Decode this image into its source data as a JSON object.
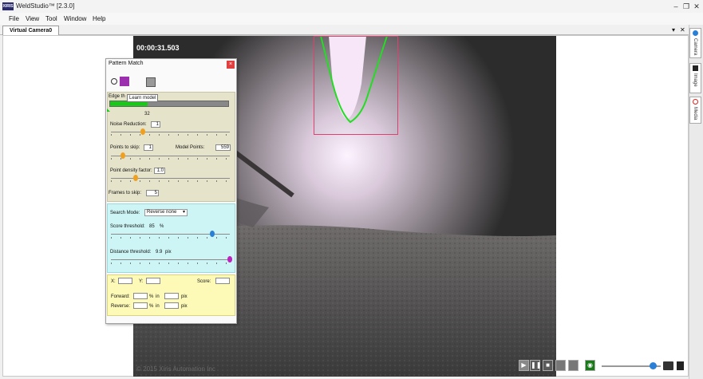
{
  "app": {
    "title": "WeldStudio™ [2.3.0]",
    "logo_text": "XIRIS"
  },
  "window_controls": {
    "minimize": "–",
    "restore": "❐",
    "close": "✕"
  },
  "menu": [
    "File",
    "View",
    "Tool",
    "Window",
    "Help"
  ],
  "tabs": [
    {
      "label": "Virtual Camera0"
    }
  ],
  "tab_controls": {
    "dropdown": "▾",
    "close": "✕"
  },
  "dock": {
    "camera": "Camera",
    "image": "Image",
    "media": "Media"
  },
  "video": {
    "timestamp": "00:00:31.503",
    "copyright": "© 2015 Xiris Automation Inc",
    "slider_level": 0.87
  },
  "pattern_match": {
    "title": "Pattern Match",
    "close": "×",
    "tooltip": "Learn model",
    "edge_threshold_label": "Edge th",
    "edge_threshold_value": "32",
    "edge_threshold_level": 0.32,
    "noise_reduction_label": "Noise Reduction:",
    "noise_reduction_value": "1",
    "noise_reduction_level": 0.27,
    "points_to_skip_label": "Points to skip:",
    "points_to_skip_value": "1",
    "points_to_skip_level": 0.1,
    "model_points_label": "Model Points:",
    "model_points_value": "559",
    "point_density_label": "Point density factor:",
    "point_density_value": "1.0",
    "point_density_level": 0.21,
    "frames_to_skip_label": "Frames to skip:",
    "frames_to_skip_value": "5",
    "search_mode_label": "Search Mode:",
    "search_mode_value": "Reverse none",
    "score_threshold_label": "Score threshold:",
    "score_threshold_value": "85",
    "score_threshold_unit": "%",
    "score_threshold_level": 0.85,
    "distance_threshold_label": "Distance threshold:",
    "distance_threshold_value": "9.9",
    "distance_threshold_unit": "pix",
    "distance_threshold_level": 1.0,
    "x_label": "X:",
    "y_label": "Y:",
    "score_label": "Score:",
    "forward_label": "Forward:",
    "reverse_label": "Reverse:",
    "pct": "%",
    "in": "in",
    "pix": "pix"
  },
  "colors": {
    "accent": "#e04040",
    "section_edge": "#e6e3cb",
    "section_search": "#cdf5f5",
    "section_result": "#fdfab8",
    "contour": "#22dd22",
    "roi": "#e04070"
  }
}
